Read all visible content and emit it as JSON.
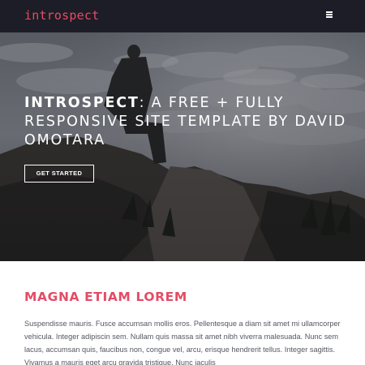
{
  "header": {
    "brand": "introspect",
    "menu_icon": "hamburger-menu-icon"
  },
  "banner": {
    "title_bold": "Introspect",
    "title_rest": ": A free + fully responsive site template by David Omotara",
    "cta_label": "Get Started"
  },
  "main": {
    "heading": "Magna Etiam Lorem",
    "body": "Suspendisse mauris. Fusce accumsan mollis eros. Pellentesque a diam sit amet mi ullamcorper vehicula. Integer adipiscin sem. Nullam quis massa sit amet nibh viverra malesuada. Nunc sem lacus, accumsan quis, faucibus non, congue vel, arcu, erisque hendrerit tellus. Integer sagittis. Vivamus a mauris eget arcu gravida tristique. Nunc iaculis"
  },
  "colors": {
    "accent": "#e44c65",
    "header_bg": "#1c1d26",
    "text": "#555760"
  }
}
